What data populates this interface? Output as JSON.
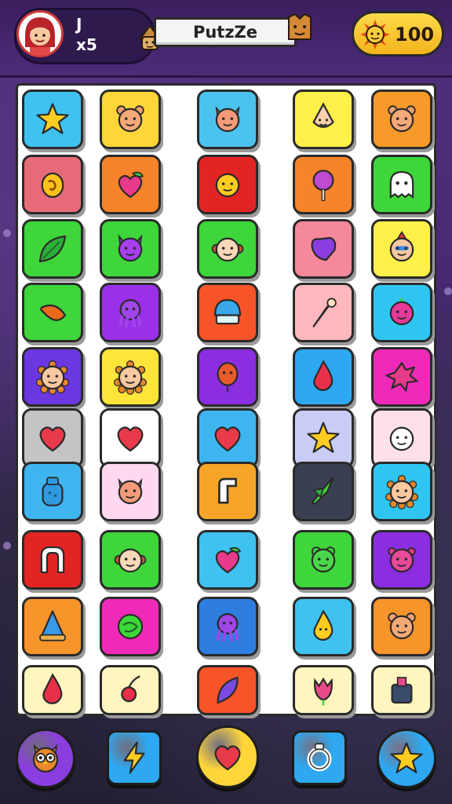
{
  "header": {
    "level": "J",
    "multiplier": "x5",
    "title": "PutzZe",
    "coins": "100",
    "avatar_icon": "girl-avatar-icon",
    "coin_icon": "sun-coin-icon"
  },
  "colors": {
    "accent": "#f2b51c",
    "board_bg": "#ffffff",
    "background_top": "#51307e",
    "background_bottom": "#231f33"
  },
  "board": {
    "columns": 5,
    "rows": 10,
    "tiles": [
      {
        "color": "#3fc2f0",
        "icon": "star-icon"
      },
      {
        "color": "#ffd53a",
        "icon": "bear-face-icon"
      },
      {
        "color": "#4bc3ee",
        "icon": "cat-face-icon"
      },
      {
        "color": "#fff04a",
        "icon": "onion-face-icon"
      },
      {
        "color": "#f79a2a",
        "icon": "bear-face-icon"
      },
      {
        "color": "#e86a78",
        "icon": "lemon-icon"
      },
      {
        "color": "#f7842a",
        "icon": "heart-leaf-icon"
      },
      {
        "color": "#e32424",
        "icon": "smiley-face-icon"
      },
      {
        "color": "#f7842a",
        "icon": "lollipop-icon"
      },
      {
        "color": "#3ed63a",
        "icon": "ghost-icon"
      },
      {
        "color": "#3ed63a",
        "icon": "leaf-icon"
      },
      {
        "color": "#3ed63a",
        "icon": "purple-cat-icon"
      },
      {
        "color": "#3ed63a",
        "icon": "monkey-face-icon"
      },
      {
        "color": "#f5889a",
        "icon": "purple-gem-icon"
      },
      {
        "color": "#fff04a",
        "icon": "clown-face-icon"
      },
      {
        "color": "#3ed63a",
        "icon": "carrot-icon"
      },
      {
        "color": "#9a30e8",
        "icon": "octopus-icon"
      },
      {
        "color": "#f7542a",
        "icon": "cupcake-icon"
      },
      {
        "color": "#ffb8bd",
        "icon": "ice-cream-cone-icon"
      },
      {
        "color": "#2ec6f0",
        "icon": "berry-face-icon"
      },
      {
        "color": "#6a37e0",
        "icon": "lion-face-icon"
      },
      {
        "color": "#ffe53a",
        "icon": "lion-face-icon"
      },
      {
        "color": "#8a2ee0",
        "icon": "balloon-face-icon"
      },
      {
        "color": "#2ea8f0",
        "icon": "drop-icon"
      },
      {
        "color": "#f02ab8",
        "icon": "splat-icon"
      },
      {
        "color": "#c4c4c4",
        "icon": "heart-icon"
      },
      {
        "color": "#ffffff",
        "icon": "heart-icon"
      },
      {
        "color": "#3fb5f0",
        "icon": "heart-icon"
      },
      {
        "color": "#c9cdf5",
        "icon": "star-icon"
      },
      {
        "color": "#ffe0ea",
        "icon": "mask-face-icon"
      },
      {
        "color": "#3fb5f0",
        "icon": "jar-icon"
      },
      {
        "color": "#ffd8ef",
        "icon": "cat-face-icon"
      },
      {
        "color": "#f7a52a",
        "icon": "hook-icon"
      },
      {
        "color": "#3a3f52",
        "icon": "rocket-icon"
      },
      {
        "color": "#2ec6f0",
        "icon": "lion-face-icon"
      },
      {
        "color": "#e32424",
        "icon": "magnet-icon"
      },
      {
        "color": "#3ed63a",
        "icon": "monkey-face-icon"
      },
      {
        "color": "#3fc2f0",
        "icon": "heart-leaf-icon"
      },
      {
        "color": "#3ed63a",
        "icon": "frog-face-icon"
      },
      {
        "color": "#8a2ee0",
        "icon": "monster-face-icon"
      },
      {
        "color": "#f7942a",
        "icon": "cone-hat-icon"
      },
      {
        "color": "#f02ab8",
        "icon": "lime-icon"
      },
      {
        "color": "#2e7ee0",
        "icon": "octopus-icon"
      },
      {
        "color": "#3fc2f0",
        "icon": "drop-face-icon"
      },
      {
        "color": "#f7942a",
        "icon": "bear-face-icon"
      },
      {
        "color": "#fff5bf",
        "icon": "drop-icon"
      },
      {
        "color": "#fff5bf",
        "icon": "cherry-icon"
      },
      {
        "color": "#f7542a",
        "icon": "feather-icon"
      },
      {
        "color": "#fff5bf",
        "icon": "tulip-icon"
      },
      {
        "color": "#fff5bf",
        "icon": "potion-icon"
      }
    ]
  },
  "bottom_bar": {
    "buttons": [
      {
        "name": "owl-button",
        "icon": "owl-icon",
        "color": "#8a3ee0"
      },
      {
        "name": "lightning-button",
        "icon": "lightning-icon",
        "color": "#2ea8f0"
      },
      {
        "name": "heart-button",
        "icon": "heart-icon",
        "color": "#ffd53a"
      },
      {
        "name": "ring-button",
        "icon": "ring-icon",
        "color": "#2ea8f0"
      },
      {
        "name": "star-button",
        "icon": "star-icon",
        "color": "#2ea8f0"
      }
    ]
  }
}
